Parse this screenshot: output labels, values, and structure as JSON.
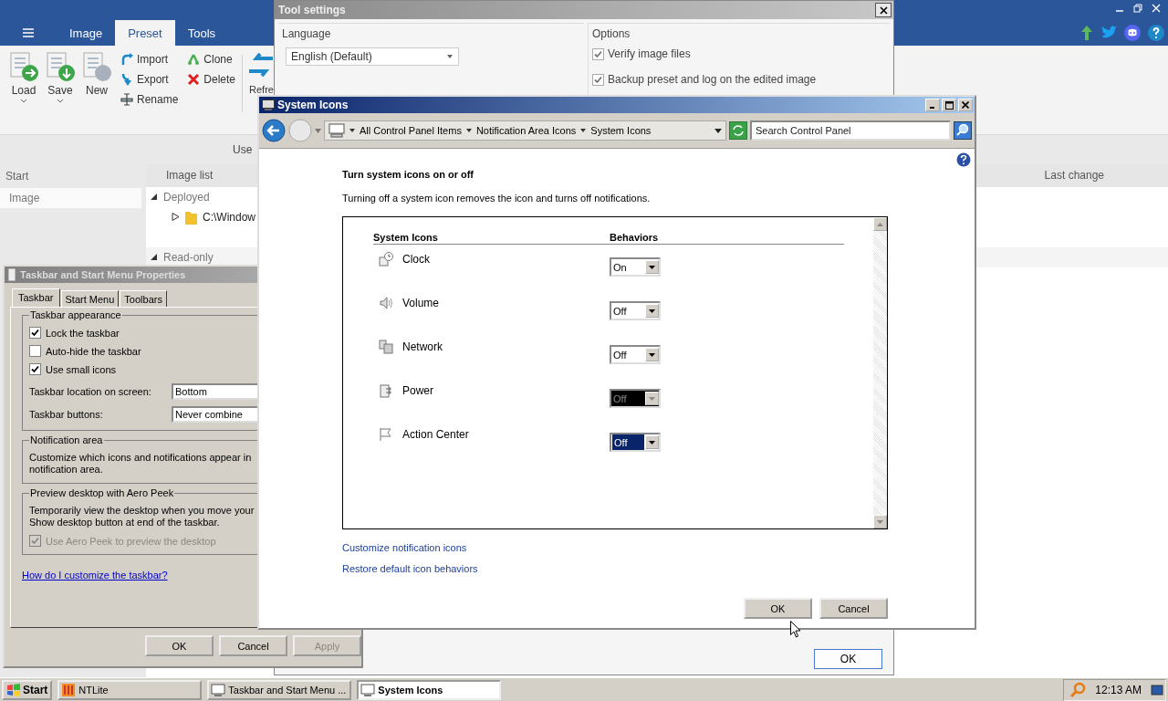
{
  "ntlite": {
    "tabs": [
      {
        "label": "Image",
        "selected": false
      },
      {
        "label": "Preset",
        "selected": true
      },
      {
        "label": "Tools",
        "selected": false
      }
    ],
    "ribbon": {
      "large_buttons": [
        {
          "label": "Load",
          "dropdown": true
        },
        {
          "label": "Save",
          "dropdown": true
        },
        {
          "label": "New",
          "dropdown": false
        }
      ],
      "small_buttons": [
        {
          "label": "Import"
        },
        {
          "label": "Export"
        },
        {
          "label": "Rename"
        },
        {
          "label": "Clone"
        },
        {
          "label": "Delete"
        }
      ],
      "cut_button": "Refre"
    },
    "hint": "Use",
    "start_pane": {
      "header": "Start",
      "items": [
        {
          "label": "Image",
          "selected": true
        }
      ]
    },
    "image_list": {
      "header": "Image list",
      "groups": [
        {
          "label": "Deployed",
          "expanded": true,
          "children": [
            {
              "label": "C:\\Window",
              "expanded": false
            }
          ]
        },
        {
          "label": "Read-only",
          "expanded": true
        }
      ]
    },
    "last_change_header": "Last change"
  },
  "tool_settings": {
    "title": "Tool settings",
    "language": {
      "label": "Language",
      "value": "English (Default)"
    },
    "options": {
      "label": "Options",
      "checkboxes": [
        {
          "label": "Verify image files",
          "checked": true
        },
        {
          "label": "Backup preset and log on the edited image",
          "checked": true
        }
      ]
    },
    "ok": "OK"
  },
  "taskbar_properties": {
    "title": "Taskbar and Start Menu Properties",
    "tabs": [
      {
        "label": "Taskbar",
        "selected": true
      },
      {
        "label": "Start Menu",
        "selected": false
      },
      {
        "label": "Toolbars",
        "selected": false
      }
    ],
    "appearance": {
      "label": "Taskbar appearance",
      "checkboxes": [
        {
          "label": "Lock the taskbar",
          "checked": true
        },
        {
          "label": "Auto-hide the taskbar",
          "checked": false
        },
        {
          "label": "Use small icons",
          "checked": true
        }
      ],
      "fields": [
        {
          "label": "Taskbar location on screen:",
          "value": "Bottom"
        },
        {
          "label": "Taskbar buttons:",
          "value": "Never combine"
        }
      ]
    },
    "notification": {
      "label": "Notification area",
      "lines": [
        "Customize which icons and notifications appear in",
        "notification area."
      ]
    },
    "aero_peek": {
      "label": "Preview desktop with Aero Peek",
      "lines": [
        "Temporarily view the desktop when you move your",
        "Show desktop button at end of the taskbar."
      ],
      "checkbox": {
        "label": "Use Aero Peek to preview the desktop",
        "checked": true,
        "disabled": true
      }
    },
    "help_link": "How do I customize the taskbar?",
    "buttons": [
      {
        "label": "OK",
        "disabled": false
      },
      {
        "label": "Cancel",
        "disabled": false
      },
      {
        "label": "Apply",
        "disabled": true
      }
    ]
  },
  "system_icons": {
    "title": "System Icons",
    "breadcrumbs": [
      "All Control Panel Items",
      "Notification Area Icons",
      "System Icons"
    ],
    "search": {
      "placeholder": "Search Control Panel"
    },
    "heading": "Turn system icons on or off",
    "description": "Turning off a system icon removes the icon and turns off notifications.",
    "columns": [
      "System Icons",
      "Behaviors"
    ],
    "rows": [
      {
        "name": "Clock",
        "behavior": "On",
        "disabled": false,
        "focused": false
      },
      {
        "name": "Volume",
        "behavior": "Off",
        "disabled": false,
        "focused": false
      },
      {
        "name": "Network",
        "behavior": "Off",
        "disabled": false,
        "focused": false
      },
      {
        "name": "Power",
        "behavior": "Off",
        "disabled": true,
        "focused": false
      },
      {
        "name": "Action Center",
        "behavior": "Off",
        "disabled": false,
        "focused": true
      }
    ],
    "links": [
      "Customize notification icons",
      "Restore default icon behaviors"
    ],
    "buttons": [
      "OK",
      "Cancel"
    ]
  },
  "taskbar": {
    "start": "Start",
    "items": [
      {
        "label": "NTLite",
        "selected": false
      },
      {
        "label": "Taskbar and Start Menu ...",
        "selected": false
      },
      {
        "label": "System Icons",
        "selected": true
      }
    ],
    "clock": "12:13 AM"
  }
}
